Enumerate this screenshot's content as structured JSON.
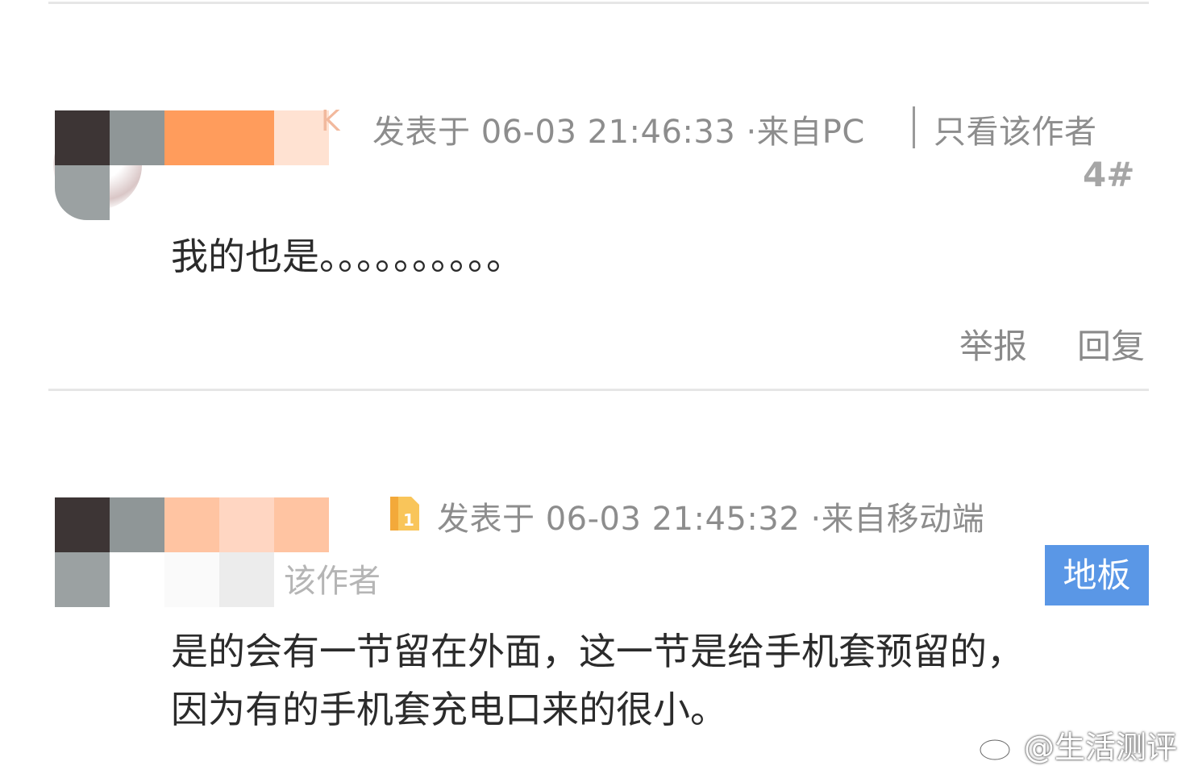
{
  "colors": {
    "divider": "#e6e6e6",
    "meta_text": "#8d8d8d",
    "content_text": "#2b2b2b",
    "badge_bg": "#5a97e6",
    "badge_text": "#ffffff"
  },
  "posts": [
    {
      "meta": "发表于 06-03 21:46:33 ·来自PC",
      "only_author": "只看该作者",
      "floor": "4#",
      "content": "我的也是。。。。。。。。。。",
      "actions": {
        "report": "举报",
        "reply": "回复"
      },
      "avatar_icon": "pixelated-avatar-icon"
    },
    {
      "meta": "发表于 06-03 21:45:32 ·来自移动端",
      "only_author_partial": "该作者",
      "floor_badge": "地板",
      "content_lines": [
        "是的会有一节留在外面，这一节是给手机套预留的，",
        "因为有的手机套充电口来的很小。"
      ],
      "avatar_icon": "pixelated-avatar-icon",
      "medal_icon": "medal-icon"
    }
  ],
  "watermark": {
    "icon": "weibo-icon",
    "text": "@生活测评"
  }
}
